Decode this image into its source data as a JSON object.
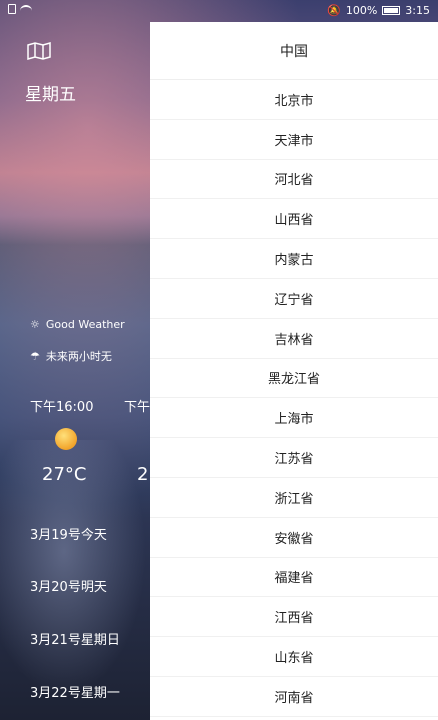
{
  "status_bar": {
    "battery": "100%",
    "time": "3:15"
  },
  "main": {
    "weekday": "星期五",
    "weather_status": "Good Weather",
    "rain_notice": "未来两小时无",
    "hours": [
      {
        "time": "下午16:00",
        "temp": "27°C"
      },
      {
        "time": "下午",
        "temp": "2"
      }
    ],
    "days": [
      "3月19号今天",
      "3月20号明天",
      "3月21号星期日",
      "3月22号星期一"
    ]
  },
  "drawer": {
    "title": "中国",
    "provinces": [
      "北京市",
      "天津市",
      "河北省",
      "山西省",
      "内蒙古",
      "辽宁省",
      "吉林省",
      "黑龙江省",
      "上海市",
      "江苏省",
      "浙江省",
      "安徽省",
      "福建省",
      "江西省",
      "山东省",
      "河南省"
    ]
  }
}
